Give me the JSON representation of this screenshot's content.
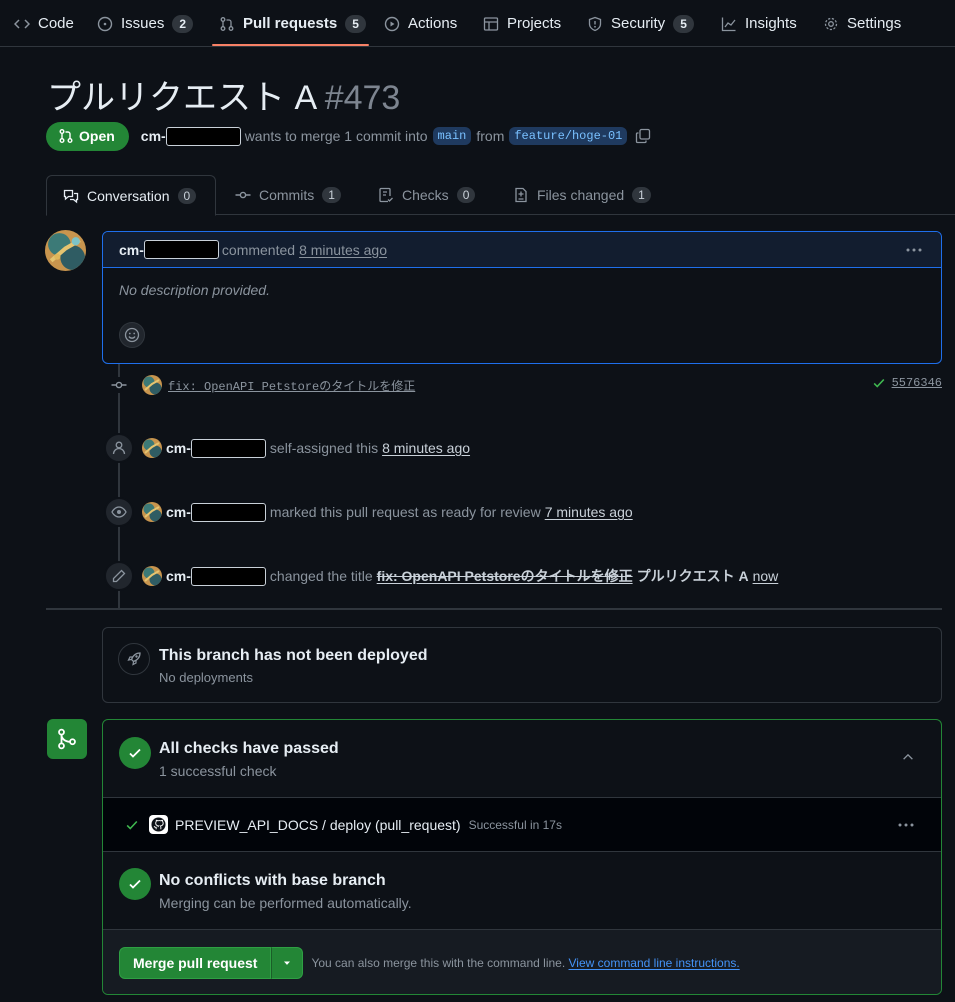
{
  "repo_nav": {
    "tabs": [
      {
        "label": "Code",
        "icon": "code-icon"
      },
      {
        "label": "Issues",
        "icon": "issue-opened-icon",
        "count": "2"
      },
      {
        "label": "Pull requests",
        "icon": "git-pull-request-icon",
        "count": "5",
        "active": true
      },
      {
        "label": "Actions",
        "icon": "play-icon"
      },
      {
        "label": "Projects",
        "icon": "table-icon"
      },
      {
        "label": "Security",
        "icon": "shield-icon",
        "count": "5"
      },
      {
        "label": "Insights",
        "icon": "graph-icon"
      },
      {
        "label": "Settings",
        "icon": "gear-icon"
      }
    ],
    "active_underline_color": "#f78166"
  },
  "pr": {
    "title": "プルリクエスト A",
    "number": "#473",
    "state": "Open",
    "author_prefix": "cm-",
    "merge_text": "wants to merge 1 commit into",
    "base_branch": "main",
    "from_text": "from",
    "head_branch": "feature/hoge-01"
  },
  "pr_tabs": [
    {
      "label": "Conversation",
      "count": "0",
      "icon": "comment-discussion-icon"
    },
    {
      "label": "Commits",
      "count": "1",
      "icon": "git-commit-icon"
    },
    {
      "label": "Checks",
      "count": "0",
      "icon": "checklist-icon"
    },
    {
      "label": "Files changed",
      "count": "1",
      "icon": "file-diff-icon"
    }
  ],
  "comment": {
    "author_prefix": "cm-",
    "action": "commented",
    "time": "8 minutes ago",
    "body": "No description provided."
  },
  "timeline": {
    "commit": {
      "message": "fix: OpenAPI Petstoreのタイトルを修正",
      "sha": "5576346"
    },
    "events": [
      {
        "icon": "person-icon",
        "author_prefix": "cm-",
        "text": "self-assigned this",
        "time": "8 minutes ago"
      },
      {
        "icon": "eye-icon",
        "author_prefix": "cm-",
        "text": "marked this pull request as ready for review",
        "time": "7 minutes ago"
      },
      {
        "icon": "pencil-icon",
        "author_prefix": "cm-",
        "text": "changed the title",
        "old_title": "fix: OpenAPI Petstoreのタイトルを修正",
        "new_title": "プルリクエスト A",
        "time": "now"
      }
    ]
  },
  "deployments": {
    "title": "This branch has not been deployed",
    "subtitle": "No deployments"
  },
  "merge_box": {
    "checks_title": "All checks have passed",
    "checks_subtitle": "1 successful check",
    "check": {
      "name": "PREVIEW_API_DOCS / deploy (pull_request)",
      "status": "Successful in 17s"
    },
    "conflicts_title": "No conflicts with base branch",
    "conflicts_subtitle": "Merging can be performed automatically.",
    "merge_button": "Merge pull request",
    "hint": "You can also merge this with the command line.",
    "hint_link": "View command line instructions."
  },
  "colors": {
    "success": "#238636",
    "link": "#4493f8",
    "focus_border": "#1f6feb",
    "background": "#0d1117"
  }
}
